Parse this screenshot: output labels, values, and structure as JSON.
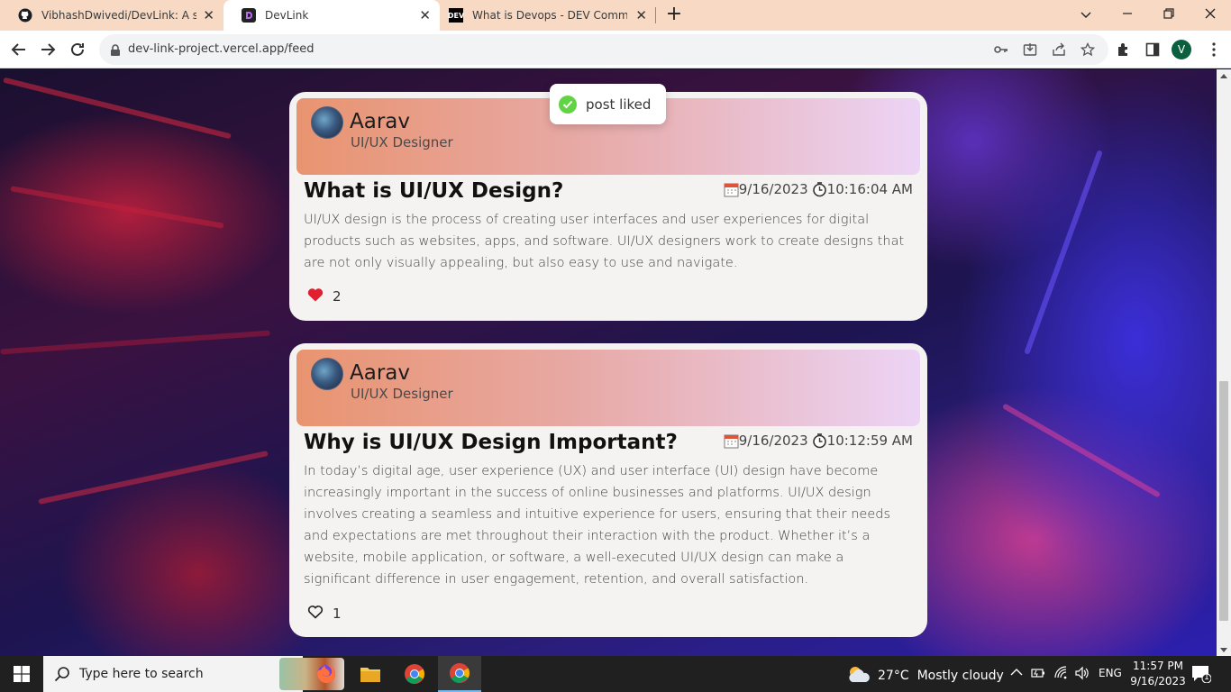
{
  "browser": {
    "tabs": [
      {
        "title": "VibhashDwivedi/DevLink: A socia",
        "favicon": "github-icon",
        "active": false
      },
      {
        "title": "DevLink",
        "favicon": "devlink-icon",
        "active": true
      },
      {
        "title": "What is Devops - DEV Communit",
        "favicon": "dev-icon",
        "active": false
      }
    ],
    "url": "dev-link-project.vercel.app/feed",
    "profile_initial": "V",
    "favicon_dev_text": "DEV"
  },
  "toast": {
    "message": "post liked"
  },
  "posts": [
    {
      "author": "Aarav",
      "role": "UI/UX Designer",
      "title": "What is UI/UX Design?",
      "date": "9/16/2023",
      "time": "10:16:04 AM",
      "body": "UI/UX design is the process of creating user interfaces and user experiences for digital products such as websites, apps, and software. UI/UX designers work to create designs that are not only visually appealing, but also easy to use and navigate.",
      "likes": "2",
      "liked": true
    },
    {
      "author": "Aarav",
      "role": "UI/UX Designer",
      "title": "Why is UI/UX Design Important?",
      "date": "9/16/2023",
      "time": "10:12:59 AM",
      "body": "In today’s digital age, user experience (UX) and user interface (UI) design have become increasingly important in the success of online businesses and platforms. UI/UX design involves creating a seamless and intuitive experience for users, ensuring that their needs and expectations are met throughout their interaction with the product. Whether it’s a website, mobile application, or software, a well-executed UI/UX design can make a significant difference in user engagement, retention, and overall satisfaction.",
      "likes": "1",
      "liked": false
    }
  ],
  "taskbar": {
    "search_placeholder": "Type here to search",
    "weather_temp": "27°C",
    "weather_desc": "Mostly cloudy",
    "language": "ENG",
    "time": "11:57 PM",
    "date": "9/16/2023",
    "notification_count": "1"
  },
  "colors": {
    "like_red": "#e0202e",
    "toast_check": "#61d345",
    "header_start": "#e99470",
    "header_end": "#ecd4f6"
  }
}
